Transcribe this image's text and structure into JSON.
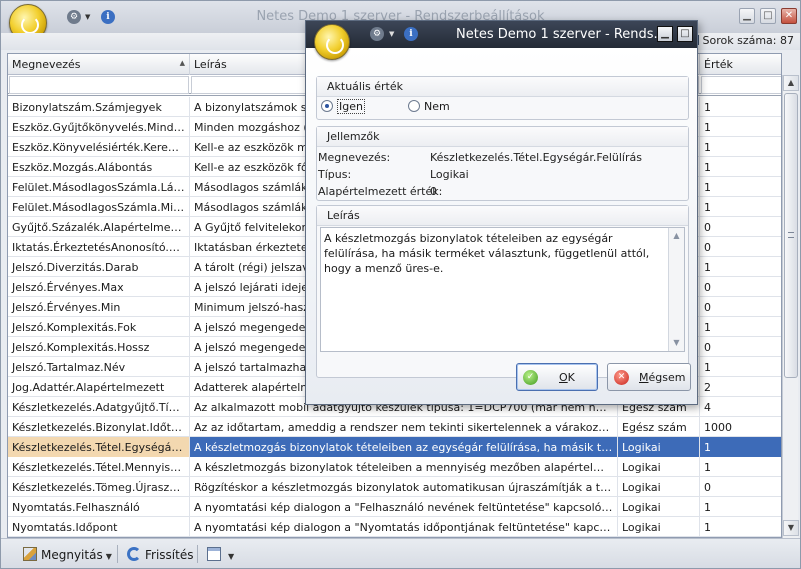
{
  "main_window": {
    "title": "Netes Demo 1 szerver - Rendszerbeállítások",
    "row_count_label": "Sorok száma: 87"
  },
  "grid": {
    "columns": [
      "Megnevezés",
      "Leírás",
      "",
      "Érték"
    ],
    "rows": [
      {
        "name": "Bizonylatszám.Számjegyek",
        "desc": "A bizonylatszámok sorszámának számjegyei",
        "type": "",
        "value": "1"
      },
      {
        "name": "Eszköz.Gyűjtőkönyvelés.Mindenm...",
        "desc": "Minden mozgáshoz (aktiválás, értékcsökkenés...)",
        "type": "",
        "value": "1"
      },
      {
        "name": "Eszköz.Könyvelésiérték.Kerekítés",
        "desc": "Kell-e az eszközök mozgásainak kerekítése",
        "type": "",
        "value": "1"
      },
      {
        "name": "Eszköz.Mozgás.Alábontás",
        "desc": "Kell-e az eszközök főkönyvi mozgásainak alábontása",
        "type": "",
        "value": "1"
      },
      {
        "name": "Felület.MásodlagosSzámla.Látható",
        "desc": "Másodlagos számlákra kerüljön-e a látható",
        "type": "",
        "value": "1"
      },
      {
        "name": "Felület.MásodlagosSzámla.Mindké...",
        "desc": "Másodlagos számlákra kerüljön-e mindkét",
        "type": "",
        "value": "1"
      },
      {
        "name": "Gyűjtő.Százalék.Alapértelmezett",
        "desc": "A Gyűjtő felvitelekor a százalék alapértelmezett",
        "type": "",
        "value": "0"
      },
      {
        "name": "Iktatás.ÉrkeztetésAnonosító.Meg...",
        "desc": "Iktatásban érkeztetett dokumentumok azonosítója",
        "type": "",
        "value": "0"
      },
      {
        "name": "Jelszó.Diverzitás.Darab",
        "desc": "A tárolt (régi) jelszavak száma",
        "type": "",
        "value": "1"
      },
      {
        "name": "Jelszó.Érvényes.Max",
        "desc": "A jelszó lejárati ideje [nap]",
        "type": "",
        "value": "0"
      },
      {
        "name": "Jelszó.Érvényes.Min",
        "desc": "Minimum jelszó-használati idő",
        "type": "",
        "value": "0"
      },
      {
        "name": "Jelszó.Komplexitás.Fok",
        "desc": "A jelszó megengedett minimális komplexitása",
        "type": "",
        "value": "1"
      },
      {
        "name": "Jelszó.Komplexitás.Hossz",
        "desc": "A jelszó megengedett minimális hossza",
        "type": "",
        "value": "0"
      },
      {
        "name": "Jelszó.Tartalmaz.Név",
        "desc": "A jelszó tartalmazhatja a nevet",
        "type": "",
        "value": "1"
      },
      {
        "name": "Jog.Adattér.Alapértelmezett",
        "desc": "Adatterek alapértelmezett jogosultsága",
        "type": "",
        "value": "2"
      },
      {
        "name": "Készletkezelés.Adatgyűjtő.Típus",
        "desc": "Az alkalmazott mobil adatgyűjtő készülék típusa: 1=DCP700 (már nem használható), 2=...",
        "type": "Egész szám",
        "value": "4"
      },
      {
        "name": "Készletkezelés.Bizonylat.Időtúllépés",
        "desc": "Az az időtartam, ameddig a rendszer nem tekinti sikertelennek a várakozó tranzakció...",
        "type": "Egész szám",
        "value": "1000"
      },
      {
        "name": "Készletkezelés.Tétel.Egységár.Fe...",
        "desc": "A készletmozgás bizonylatok tételeiben az egységár felülírása, ha másik terméket vál...",
        "type": "Logikai",
        "value": "1",
        "selected": true
      },
      {
        "name": "Készletkezelés.Tétel.Mennyiség....",
        "desc": "A készletmozgás bizonylatok tételeiben a mennyiség mezőben alapértelmezetten egy...",
        "type": "Logikai",
        "value": "1"
      },
      {
        "name": "Készletkezelés.Tömeg.Újraszámítás",
        "desc": "Rögzítéskor a készletmozgás bizonylatok automatikusan újraszámítják a tömeg adato...",
        "type": "Logikai",
        "value": "0"
      },
      {
        "name": "Nyomtatás.Felhasználó",
        "desc": "A nyomtatási kép dialogon a \"Felhasználó nevének feltüntetése\" kapcsoló alapértelm...",
        "type": "Logikai",
        "value": "1"
      },
      {
        "name": "Nyomtatás.Időpont",
        "desc": "A nyomtatási kép dialogon a \"Nyomtatás időpontjának feltüntetése\" kapcsoló alapért...",
        "type": "Logikai",
        "value": "1"
      }
    ]
  },
  "toolbar": {
    "open_label": "Megnyitás",
    "refresh_label": "Frissítés"
  },
  "dialog": {
    "title": "Netes Demo 1 szerver - Rends...",
    "current_value_group": "Aktuális érték",
    "radio_yes": "Igen",
    "radio_no": "Nem",
    "selected": "Igen",
    "properties_group": "Jellemzők",
    "name_key": "Megnevezés:",
    "name_val": "Készletkezelés.Tétel.Egységár.Felülírás",
    "type_key": "Típus:",
    "type_val": "Logikai",
    "default_key": "Alapértelmezett érték:",
    "default_val": "0",
    "description_group": "Leírás",
    "description": "A készletmozgás bizonylatok tételeiben az egységár felülírása, ha másik terméket választunk, függetlenül attól, hogy a menző üres-e.",
    "ok_label": "OK",
    "cancel_label": "Mégsem"
  },
  "colors": {
    "selection": "#3d6bb8",
    "dialog_titlebar": "#2a313d"
  }
}
